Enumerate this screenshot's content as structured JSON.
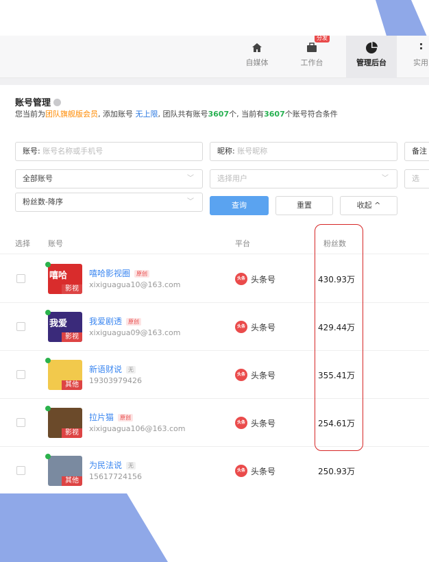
{
  "nav": {
    "items": [
      {
        "label": "自媒体",
        "icon": "home-icon",
        "active": false
      },
      {
        "label": "工作台",
        "icon": "briefcase-icon",
        "active": false,
        "badge": "分发"
      },
      {
        "label": "管理后台",
        "icon": "pie-chart-icon",
        "active": true
      },
      {
        "label": "实用",
        "icon": "more-icon",
        "active": false
      }
    ]
  },
  "header": {
    "title": "账号管理",
    "info": {
      "p1": "您当前为",
      "member": "团队旗舰版会员",
      "p2": ", 添加账号 ",
      "unlimited": "无上限",
      "p3": ", 团队共有账号",
      "total": "3607",
      "p4": "个, 当前有",
      "match": "3607",
      "p5": "个账号符合条件"
    }
  },
  "filters": {
    "account_label": "账号:",
    "account_placeholder": "账号名称或手机号",
    "nickname_label": "昵称:",
    "nickname_placeholder": "账号昵称",
    "remark_label": "备注",
    "account_scope": "全部账号",
    "user_placeholder": "选择用户",
    "extra_placeholder": "选",
    "sort": "粉丝数-降序",
    "query_btn": "查询",
    "reset_btn": "重置",
    "collapse_btn": "收起 ^"
  },
  "table": {
    "headers": {
      "select": "选择",
      "account": "账号",
      "platform": "平台",
      "fans": "粉丝数"
    },
    "rows": [
      {
        "name": "嘻哈影视圈",
        "tag": "原创",
        "sub": "xixiguagua10@163.com",
        "platform": "头条号",
        "platform_icon": "头条",
        "fans": "430.93万",
        "avatar_tag": "影视",
        "avatar_text": "嘻哈",
        "avatar_color": "#d92c2c"
      },
      {
        "name": "我爱剧透",
        "tag": "原创",
        "sub": "xixiguagua09@163.com",
        "platform": "头条号",
        "platform_icon": "头条",
        "fans": "429.44万",
        "avatar_tag": "影视",
        "avatar_text": "我爱",
        "avatar_color": "#3a2a7a"
      },
      {
        "name": "新语财说",
        "tag": "无",
        "sub": "19303979426",
        "platform": "头条号",
        "platform_icon": "头条",
        "fans": "355.41万",
        "avatar_tag": "其他",
        "avatar_text": "",
        "avatar_color": "#f2c94c"
      },
      {
        "name": "拉片猫",
        "tag": "原创",
        "sub": "xixiguagua106@163.com",
        "platform": "头条号",
        "platform_icon": "头条",
        "fans": "254.61万",
        "avatar_tag": "影视",
        "avatar_text": "",
        "avatar_color": "#6b4a2a"
      },
      {
        "name": "为民法说",
        "tag": "无",
        "sub": "15617724156",
        "platform": "头条号",
        "platform_icon": "头条",
        "fans": "250.93万",
        "avatar_tag": "其他",
        "avatar_text": "",
        "avatar_color": "#7a8aa0"
      }
    ]
  },
  "colors": {
    "accent": "#3a86f0",
    "decor": "#8aa6e6",
    "highlight": "#d62424"
  }
}
